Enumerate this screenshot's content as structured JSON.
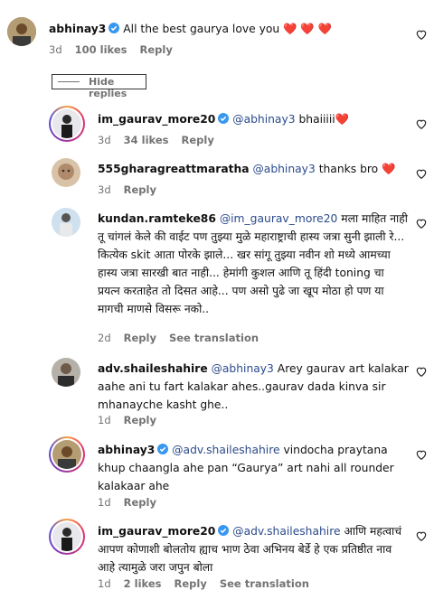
{
  "comments": [
    {
      "user": "abhinay3",
      "verified": true,
      "text": "All the best gaurya love you",
      "emoji": "❤️ ❤️ ❤️",
      "time": "3d",
      "likes": "100 likes",
      "reply": "Reply",
      "translate": ""
    },
    {
      "user": "im_gaurav_more20",
      "verified": true,
      "mention": "@abhinay3",
      "text": "bhaiiiii",
      "emoji": "❤️",
      "time": "3d",
      "likes": "34 likes",
      "reply": "Reply",
      "translate": ""
    },
    {
      "user": "555gharagreattmaratha",
      "verified": false,
      "mention": "@abhinay3",
      "text": "thanks bro",
      "emoji": "❤️",
      "time": "3d",
      "likes": "",
      "reply": "Reply",
      "translate": ""
    },
    {
      "user": "kundan.ramteke86",
      "verified": false,
      "mention": "@im_gaurav_more20",
      "text": "मला माहित नाही तू चांगलं केले की वाईट पण तुझ्या मुळे महाराष्ट्राची हास्य जत्रा सुनी झाली रे... कित्येक skit आता पोरके झाले... खर सांगू तुझ्या नवीन शो मध्ये आमच्या हास्य जत्रा सारखी बात नाही... हेमांगी कुशल आणि तू हिंदी toning चा प्रयत्न करताहेत तो दिसत आहे... पण असो पुढे जा खूप मोठा हो पण या मागची माणसे विसरू नको..",
      "emoji": "",
      "time": "2d",
      "likes": "",
      "reply": "Reply",
      "translate": "See translation"
    },
    {
      "user": "adv.shaileshahire",
      "verified": false,
      "mention": "@abhinay3",
      "text": "Arey gaurav art kalakar aahe ani tu fart kalakar ahes..gaurav dada kinva sir mhanayche kasht ghe..",
      "emoji": "",
      "time": "1d",
      "likes": "",
      "reply": "Reply",
      "translate": ""
    },
    {
      "user": "abhinay3",
      "verified": true,
      "mention": "@adv.shaileshahire",
      "text": "vindocha praytana khup chaangla ahe pan “Gaurya” art nahi all rounder kalakaar ahe",
      "emoji": "",
      "time": "1d",
      "likes": "",
      "reply": "Reply",
      "translate": ""
    },
    {
      "user": "im_gaurav_more20",
      "verified": true,
      "mention": "@adv.shaileshahire",
      "text": "आणि महत्वाचं आपण कोणाशी बोलतोय ह्याच भाण ठेवा अभिनय बेर्डे हे एक प्रतिष्ठीत नाव आहे त्यामुळे जरा जपुन बोला",
      "emoji": "",
      "time": "1d",
      "likes": "2 likes",
      "reply": "Reply",
      "translate": "See translation"
    }
  ],
  "hide_replies": "Hide replies",
  "colors": {
    "mention": "#2b4a8c",
    "meta": "#737373",
    "heart_emoji": "#e0245e"
  }
}
